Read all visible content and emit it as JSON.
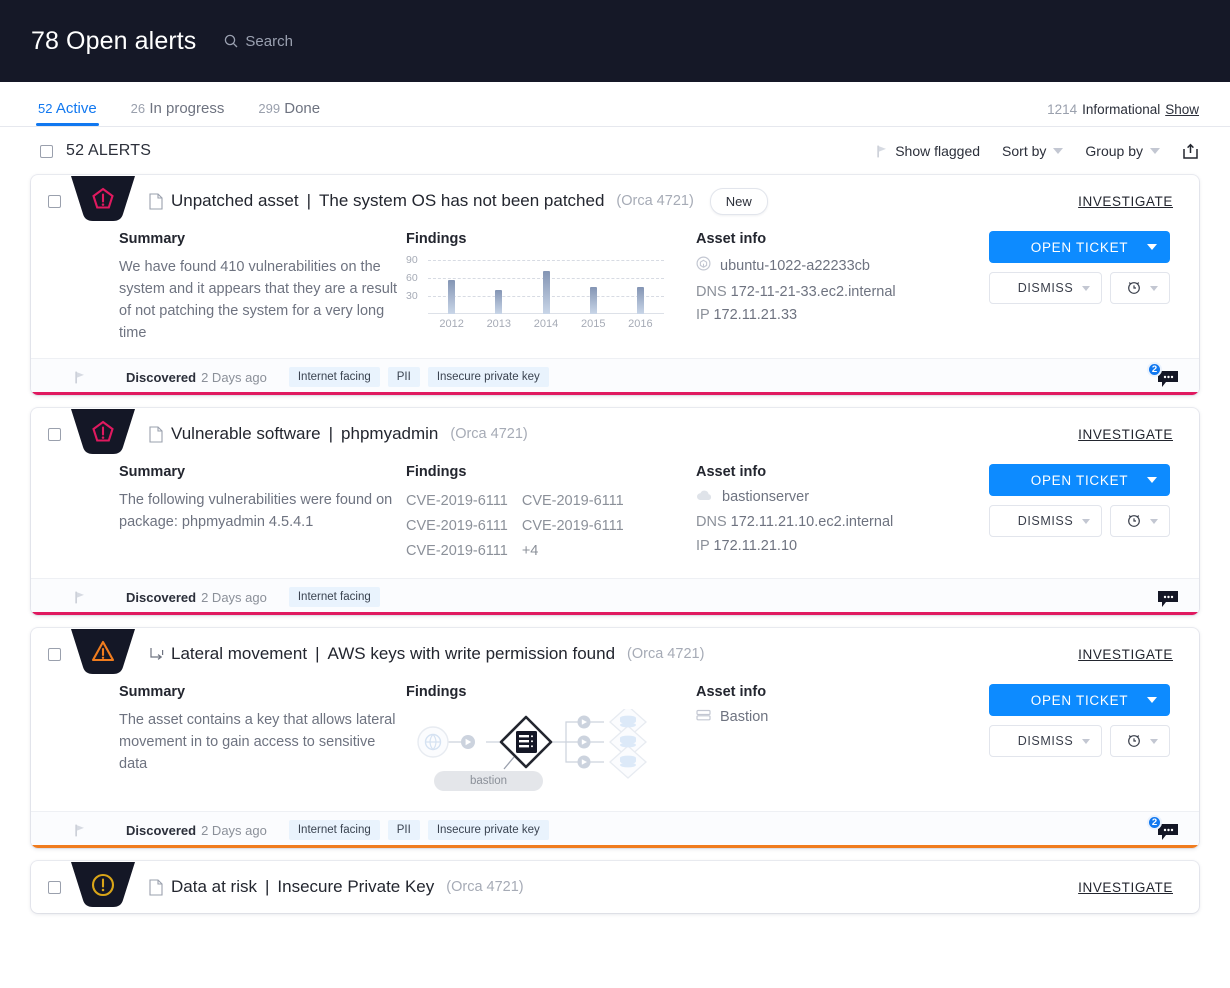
{
  "header": {
    "title": "78 Open alerts",
    "search_placeholder": "Search",
    "search_icon": "search-icon"
  },
  "tabs": [
    {
      "count": "52",
      "label": "Active",
      "active": true
    },
    {
      "count": "26",
      "label": "In progress",
      "active": false
    },
    {
      "count": "299",
      "label": "Done",
      "active": false
    }
  ],
  "tabs_right": {
    "count": "1214",
    "label": "Informational",
    "show_label": "Show"
  },
  "toolbar": {
    "alerts_count": "52 ALERTS",
    "show_flagged": "Show flagged",
    "sort_by": "Sort by",
    "group_by": "Group by",
    "share_icon": "share-export-icon",
    "flag_icon": "flag-icon"
  },
  "common": {
    "summary_label": "Summary",
    "findings_label": "Findings",
    "asset_label": "Asset info",
    "investigate_label": "INVESTIGATE",
    "open_ticket_label": "OPEN TICKET",
    "dismiss_label": "DISMISS",
    "snooze_icon": "alarm-clock-icon",
    "discovered_label": "Discovered",
    "dns_label": "DNS",
    "ip_label": "IP"
  },
  "cards": [
    {
      "severity": "critical",
      "severity_icon": "pentagon-alert-icon",
      "type_icon": "document-icon",
      "title": "Unpatched asset",
      "separator": "|",
      "subtitle": "The system OS has not been patched",
      "orca_id": "(Orca 4721)",
      "badge": "New",
      "summary": "We have found 410 vulnerabilities on the system and it appears that they are a result of not patching the system for a very long time",
      "findings_type": "chart",
      "asset": {
        "icon": "vm-instance-icon",
        "name": "ubuntu-1022-a22233cb",
        "dns": "172-11-21-33.ec2.internal",
        "ip": "172.11.21.33"
      },
      "discovered": "2 Days ago",
      "tags": [
        "Internet facing",
        "PII",
        "Insecure private key"
      ],
      "comments": "2",
      "accent": "crimson",
      "accent_color": "#e0195f"
    },
    {
      "severity": "critical",
      "severity_icon": "pentagon-alert-icon",
      "type_icon": "document-icon",
      "title": "Vulnerable software",
      "separator": "|",
      "subtitle": "phpmyadmin",
      "orca_id": "(Orca 4721)",
      "badge": null,
      "summary": "The following vulnerabilities were found on package: phpmyadmin 4.5.4.1",
      "findings_type": "cve",
      "cves": [
        [
          "CVE-2019-6111",
          "CVE-2019-6111"
        ],
        [
          "CVE-2019-6111",
          "CVE-2019-6111"
        ],
        [
          "CVE-2019-6111",
          "+4"
        ]
      ],
      "asset": {
        "icon": "cloud-icon",
        "name": "bastionserver",
        "dns": "172.11.21.10.ec2.internal",
        "ip": "172.11.21.10"
      },
      "discovered": "2 Days ago",
      "tags": [
        "Internet facing"
      ],
      "comments": null,
      "accent": "crimson",
      "accent_color": "#e0195f"
    },
    {
      "severity": "warning",
      "severity_icon": "triangle-warning-icon",
      "type_icon": "lateral-movement-icon",
      "title": "Lateral movement",
      "separator": "|",
      "subtitle": "AWS keys with write permission found",
      "orca_id": "(Orca 4721)",
      "badge": null,
      "summary": "The asset contains a key that allows lateral movement in to gain access to sensitive data",
      "findings_type": "diagram",
      "diagram_label": "bastion",
      "asset": {
        "icon": "server-icon",
        "name": "Bastion",
        "dns": null,
        "ip": null
      },
      "discovered": "2 Days ago",
      "tags": [
        "Internet facing",
        "PII",
        "Insecure private key"
      ],
      "comments": "2",
      "accent": "orange",
      "accent_color": "#f07c1e"
    },
    {
      "severity": "medium",
      "severity_icon": "circle-alert-icon",
      "type_icon": "document-icon",
      "title": "Data at risk",
      "separator": "|",
      "subtitle": "Insecure Private Key",
      "orca_id": "(Orca 4721)",
      "badge": null,
      "summary": null,
      "findings_type": null,
      "asset": null,
      "discovered": null,
      "tags": [],
      "comments": null,
      "accent": null,
      "accent_color": null
    }
  ],
  "chart_data": {
    "type": "bar",
    "title": "Findings",
    "categories": [
      "2012",
      "2013",
      "2014",
      "2015",
      "2016"
    ],
    "values": [
      57,
      40,
      71,
      45,
      45
    ],
    "yticks": [
      30,
      60,
      90
    ],
    "ylim": [
      0,
      90
    ],
    "xlabel": "",
    "ylabel": "",
    "grid": true,
    "legend": "none"
  }
}
